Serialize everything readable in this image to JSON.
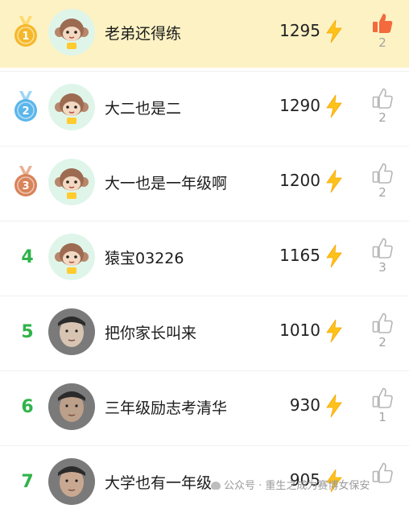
{
  "leaderboard": [
    {
      "rank": "1",
      "name": "老弟还得练",
      "score": "1295",
      "likes": "2",
      "liked": true,
      "medal": "gold",
      "avatar": "monkey-avatar"
    },
    {
      "rank": "2",
      "name": "大二也是二",
      "score": "1290",
      "likes": "2",
      "liked": false,
      "medal": "silver",
      "avatar": "monkey-avatar"
    },
    {
      "rank": "3",
      "name": "大一也是一年级啊",
      "score": "1200",
      "likes": "2",
      "liked": false,
      "medal": "bronze",
      "avatar": "monkey-avatar"
    },
    {
      "rank": "4",
      "name": "猿宝03226",
      "score": "1165",
      "likes": "3",
      "liked": false,
      "medal": null,
      "avatar": "monkey-avatar"
    },
    {
      "rank": "5",
      "name": "把你家长叫来",
      "score": "1010",
      "likes": "2",
      "liked": false,
      "medal": null,
      "avatar": "photo-avatar"
    },
    {
      "rank": "6",
      "name": "三年级励志考清华",
      "score": "930",
      "likes": "1",
      "liked": false,
      "medal": null,
      "avatar": "photo-avatar"
    },
    {
      "rank": "7",
      "name": "大学也有一年级",
      "score": "905",
      "likes": "",
      "liked": false,
      "medal": null,
      "avatar": "photo-avatar"
    }
  ],
  "icons": {
    "score": "lightning-bolt-icon",
    "like": "thumbs-up-icon"
  },
  "colors": {
    "highlight_row": "#fdf2c4",
    "rank_number": "#2fb34a",
    "bolt": "#ffc21a",
    "liked": "#f26a3d",
    "unliked": "#b5b5b5"
  },
  "watermark": "公众号 · 重生之成为赛博女保安"
}
